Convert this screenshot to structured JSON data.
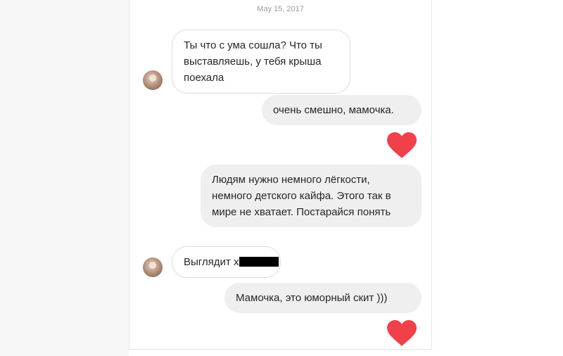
{
  "conversation": {
    "date": "May 15, 2017",
    "messages": [
      {
        "side": "in",
        "text": "Ты что с ума сошла? Что ты выставляешь, у тебя крыша поехала"
      },
      {
        "side": "out",
        "text": "очень смешно, мамочка."
      },
      {
        "side": "out",
        "text": "Людям нужно немного лёгкости, немного детского кайфа. Этого так в мире не хватает. Постарайся понять"
      },
      {
        "side": "in",
        "text": "Выглядит х"
      },
      {
        "side": "out",
        "text": "Мамочка, это юморный скит )))"
      }
    ],
    "reactions": [
      "heart-icon",
      "heart-icon"
    ],
    "colors": {
      "heart": "#f0404a",
      "bubble_out": "#efefef",
      "bubble_in_border": "#dbdbdb"
    }
  }
}
